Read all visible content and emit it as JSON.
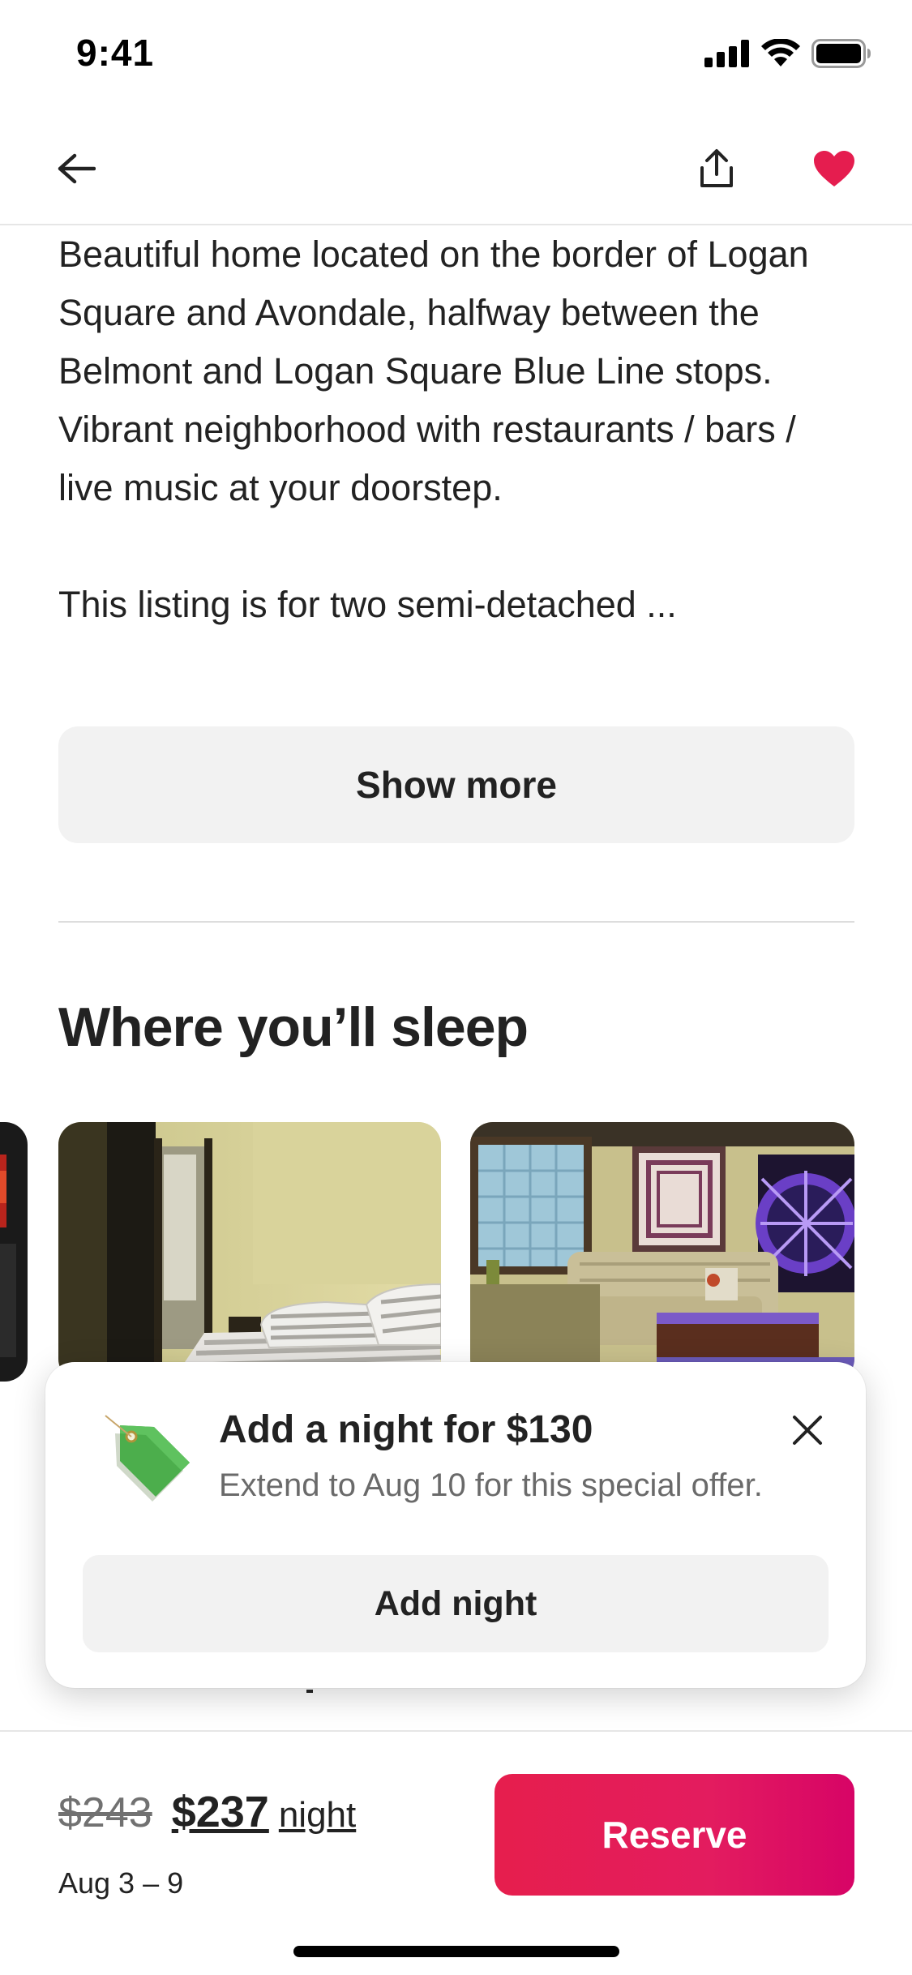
{
  "status_bar": {
    "time": "9:41"
  },
  "nav": {
    "back": "back-icon",
    "share": "share-icon",
    "favorite": "heart-icon",
    "favorite_color": "#e51d4f"
  },
  "description": {
    "paragraph_1": "Beautiful home located on the border of Logan Square and Avondale, halfway between the Belmont and Logan Square Blue Line stops. Vibrant neighborhood with restaurants / bars / live music at your doorstep.",
    "paragraph_2": "This listing is for two semi-detached ..."
  },
  "show_more_label": "Show more",
  "sleep_section": {
    "title": "Where you’ll sleep"
  },
  "offer": {
    "title": "Add a night for $130",
    "subtitle": "Extend to Aug 10 for this special offer.",
    "button_label": "Add night",
    "tag_icon": "price-tag-icon",
    "close_icon": "close-icon"
  },
  "footer": {
    "old_price": "$243",
    "new_price": "$237",
    "unit": "night",
    "dates": "Aug 3 – 9",
    "reserve_label": "Reserve",
    "reserve_color": "#e31c5f"
  }
}
